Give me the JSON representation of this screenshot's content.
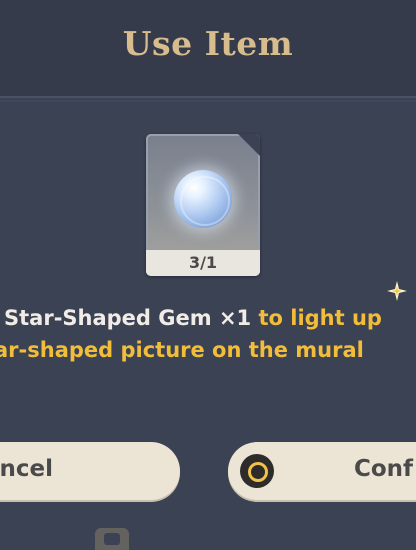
{
  "dialog": {
    "title": "Use Item",
    "item": {
      "icon": "star-shaped-gem-icon",
      "count": "3/1"
    },
    "description": {
      "line1_white": "Star-Shaped Gem ×1",
      "line1_gold": " to light up",
      "line2_gold": "ar-shaped picture on the mural"
    },
    "buttons": {
      "cancel_label": "ancel",
      "confirm_label": "Conf"
    }
  },
  "colors": {
    "title": "#d7bd8d",
    "highlight": "#f2bd38",
    "panel": "#3b4254",
    "button": "#ece5d6"
  }
}
